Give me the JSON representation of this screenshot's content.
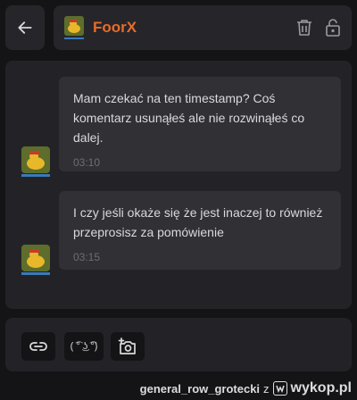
{
  "header": {
    "user_name": "FoorX",
    "icons": [
      "back-arrow-icon",
      "trash-icon",
      "lock-icon"
    ]
  },
  "messages": [
    {
      "text": "Mam czekać na ten timestamp? Coś komentarz usunąłeś ale nie rozwinąłeś co dalej.",
      "time": "03:10"
    },
    {
      "text": "I czy jeśli okaże się że jest inaczej to również przeprosisz za pomówienie",
      "time": "03:15"
    }
  ],
  "composer": {
    "lenny_label": "( ͡° ͜ʖ ͡°)",
    "icons": [
      "link-icon",
      "lenny-face-icon",
      "add-photo-icon"
    ]
  },
  "watermark": {
    "user": "general_row_grotecki",
    "separator": "z",
    "site": "wykop.pl"
  },
  "colors": {
    "background": "#141416",
    "panel": "#232327",
    "bubble": "#303035",
    "username": "#e96b2a",
    "text": "#d9d9dd",
    "time": "#6d6d73"
  }
}
